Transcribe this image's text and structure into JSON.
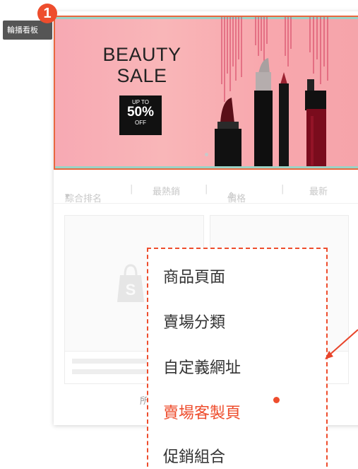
{
  "annotation": {
    "tag_label": "輪播看板",
    "step_number": "1"
  },
  "banner": {
    "title_line1": "BEAUTY",
    "title_line2": "SALE",
    "badge_upto": "UP TO",
    "badge_percent": "50%",
    "badge_off": "OFF"
  },
  "sort": {
    "relevance": "綜合排名",
    "top_sales": "最熱銷",
    "price": "價格",
    "latest": "最新",
    "separator": "|"
  },
  "products": {
    "more_text": "所"
  },
  "menu": {
    "items": [
      {
        "label": "商品頁面"
      },
      {
        "label": "賣場分類"
      },
      {
        "label": "自定義網址"
      },
      {
        "label": "賣場客製頁"
      },
      {
        "label": "促銷組合"
      }
    ],
    "active_index": 3
  },
  "colors": {
    "accent": "#ee4d2d",
    "banner_pink": "#f7a9b3",
    "banner_border": "#e8673f"
  },
  "icons": {
    "tag": "label-tag",
    "dropdown_caret": "caret-down-icon",
    "price_sort": "sort-updown-icon",
    "logo": "shopee-bag-icon"
  }
}
